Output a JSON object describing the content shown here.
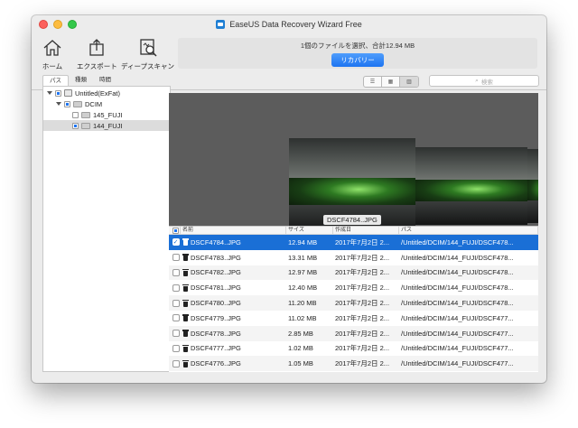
{
  "window": {
    "title": "EaseUS Data Recovery Wizard Free"
  },
  "toolbar": {
    "home_label": "ホーム",
    "export_label": "エクスポート",
    "deep_scan_label": "ディープスキャン",
    "status_text": "1個のファイルを選択、合計12.94 MB",
    "recover_label": "リカバリー"
  },
  "sidebar": {
    "tabs": [
      "パス",
      "種類",
      "時間"
    ],
    "tree": [
      {
        "label": "Untitled(ExFat)",
        "level": 0
      },
      {
        "label": "DCIM",
        "level": 1
      },
      {
        "label": "145_FUJI",
        "level": 2
      },
      {
        "label": "144_FUJI",
        "level": 2,
        "selected": true
      }
    ]
  },
  "viewbar": {
    "view_icons": [
      "list-view-icon",
      "grid-view-icon",
      "preview-view-icon"
    ],
    "search_placeholder": "検索"
  },
  "preview": {
    "caption": "DSCF4784..JPG"
  },
  "table": {
    "headers": [
      "名前",
      "サイズ",
      "作成日",
      "パス"
    ],
    "rows": [
      {
        "name": "DSCF4784..JPG",
        "size": "12.94 MB",
        "date": "2017年7月2日 2...",
        "path": "/Untitled/DCIM/144_FUJI/DSCF478...",
        "checked": true,
        "selected": true
      },
      {
        "name": "DSCF4783..JPG",
        "size": "13.31 MB",
        "date": "2017年7月2日 2...",
        "path": "/Untitled/DCIM/144_FUJI/DSCF478..."
      },
      {
        "name": "DSCF4782..JPG",
        "size": "12.97 MB",
        "date": "2017年7月2日 2...",
        "path": "/Untitled/DCIM/144_FUJI/DSCF478..."
      },
      {
        "name": "DSCF4781..JPG",
        "size": "12.40 MB",
        "date": "2017年7月2日 2...",
        "path": "/Untitled/DCIM/144_FUJI/DSCF478..."
      },
      {
        "name": "DSCF4780..JPG",
        "size": "11.20 MB",
        "date": "2017年7月2日 2...",
        "path": "/Untitled/DCIM/144_FUJI/DSCF478..."
      },
      {
        "name": "DSCF4779..JPG",
        "size": "11.02 MB",
        "date": "2017年7月2日 2...",
        "path": "/Untitled/DCIM/144_FUJI/DSCF477..."
      },
      {
        "name": "DSCF4778..JPG",
        "size": "2.85 MB",
        "date": "2017年7月2日 2...",
        "path": "/Untitled/DCIM/144_FUJI/DSCF477..."
      },
      {
        "name": "DSCF4777..JPG",
        "size": "1.02 MB",
        "date": "2017年7月2日 2...",
        "path": "/Untitled/DCIM/144_FUJI/DSCF477..."
      },
      {
        "name": "DSCF4776..JPG",
        "size": "1.05 MB",
        "date": "2017年7月2日 2...",
        "path": "/Untitled/DCIM/144_FUJI/DSCF477..."
      }
    ]
  },
  "colors": {
    "accent": "#1a6fd6",
    "recover_button": "#1d74f1"
  }
}
